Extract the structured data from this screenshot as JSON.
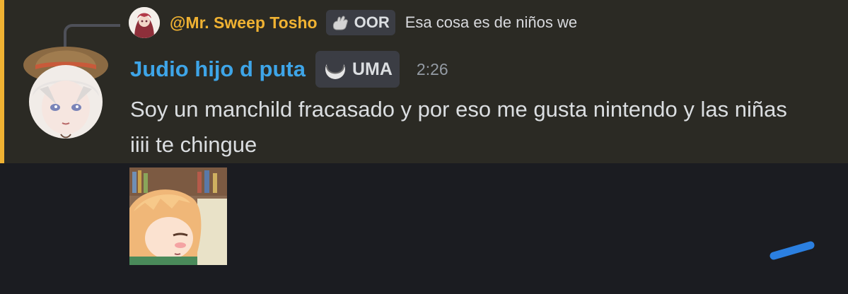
{
  "reply": {
    "author": "@Mr. Sweep Tosho",
    "tag": "OOR",
    "text": "Esa cosa es de niños we"
  },
  "message": {
    "author": "Judio hijo d puta",
    "tag": "UMA",
    "timestamp": "2:26",
    "content": "Soy un manchild fracasado y por eso me gusta nintendo y las niñas iiii te chingue"
  },
  "icons": {
    "reply_tag": "rock-hand-icon",
    "author_tag": "crescent-moon-icon"
  },
  "colors": {
    "mention_highlight": "#2b2a24",
    "mention_bar": "#f0b232",
    "reply_author": "#f0b232",
    "author": "#3ea5e8",
    "background": "#1b1c21"
  }
}
